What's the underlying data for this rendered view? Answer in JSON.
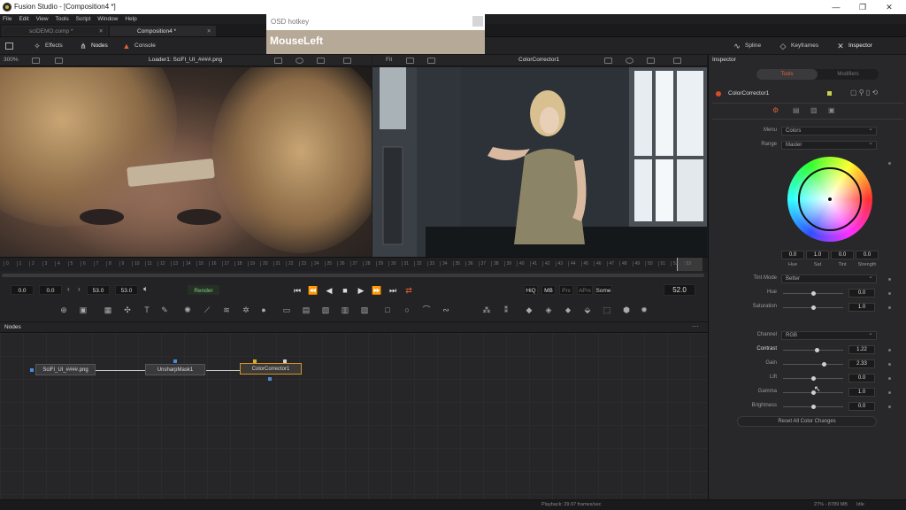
{
  "window": {
    "title": "Fusion Studio - [Composition4 *]"
  },
  "menu": [
    "File",
    "Edit",
    "View",
    "Tools",
    "Script",
    "Window",
    "Help"
  ],
  "tabs": [
    {
      "label": "sciDEMO.comp *",
      "active": false
    },
    {
      "label": "Composition4 *",
      "active": true
    }
  ],
  "toolbar": {
    "left": [
      "Effects",
      "Nodes",
      "Console"
    ],
    "right": [
      "Spline",
      "Keyframes",
      "Inspector"
    ]
  },
  "osd": {
    "title": "OSD hotkey",
    "message": "MouseLeft"
  },
  "viewer1": {
    "zoom": "300%",
    "label": "Loader1: SciFI_UI_####.png"
  },
  "viewer2": {
    "zoom": "Fit",
    "label": "ColorCorrector1"
  },
  "timeline": {
    "ticks": [
      "0",
      "1",
      "2",
      "3",
      "4",
      "5",
      "6",
      "7",
      "8",
      "9",
      "10",
      "11",
      "12",
      "13",
      "14",
      "15",
      "16",
      "17",
      "18",
      "19",
      "20",
      "21",
      "22",
      "23",
      "24",
      "25",
      "26",
      "27",
      "28",
      "29",
      "30",
      "31",
      "32",
      "33",
      "34",
      "35",
      "36",
      "37",
      "38",
      "39",
      "40",
      "41",
      "42",
      "43",
      "44",
      "45",
      "46",
      "47",
      "48",
      "49",
      "50",
      "51",
      "52",
      "53"
    ]
  },
  "transport": {
    "start": "0.0",
    "render_start": "0.0",
    "render_end": "53.0",
    "end": "53.0",
    "render_label": "Render",
    "current_time": "52.0",
    "quality": [
      "HiQ",
      "MB",
      "Prx",
      "APrx",
      "Some"
    ]
  },
  "nodes_panel": {
    "title": "Nodes",
    "nodes": [
      "SciFI_UI_####.png",
      "UnsharpMask1",
      "ColorCorrector1"
    ]
  },
  "inspector": {
    "title": "Inspector",
    "tabs": [
      "Tools",
      "Modifiers"
    ],
    "tool_name": "ColorCorrector1",
    "menu_label": "Menu",
    "menu_value": "Colors",
    "range_label": "Range",
    "range_value": "Master",
    "wheel": {
      "hue": "0.0",
      "sat": "1.0",
      "tint": "0.0",
      "strength": "0.0",
      "labels": [
        "Hue",
        "Sat",
        "Tint",
        "Strength"
      ]
    },
    "tint_mode_label": "Tint Mode",
    "tint_mode_value": "Better",
    "hue_label": "Hue",
    "hue_value": "0.0",
    "saturation_label": "Saturation",
    "saturation_value": "1.0",
    "channel_label": "Channel",
    "channel_value": "RGB",
    "contrast_label": "Contrast",
    "contrast_value": "1.22",
    "gain_label": "Gain",
    "gain_value": "2.33",
    "lift_label": "Lift",
    "lift_value": "0.0",
    "gamma_label": "Gamma",
    "gamma_value": "1.0",
    "brightness_label": "Brightness",
    "brightness_value": "0.0",
    "reset_label": "Reset All Color Changes"
  },
  "status": {
    "playback": "Playback: 29.97 frames/sec",
    "memory": "27% - 8789 MB",
    "state": "Idle"
  },
  "colors": {
    "accent": "#d4902a",
    "osd_body": "#b7a998",
    "panel": "#28282a"
  }
}
